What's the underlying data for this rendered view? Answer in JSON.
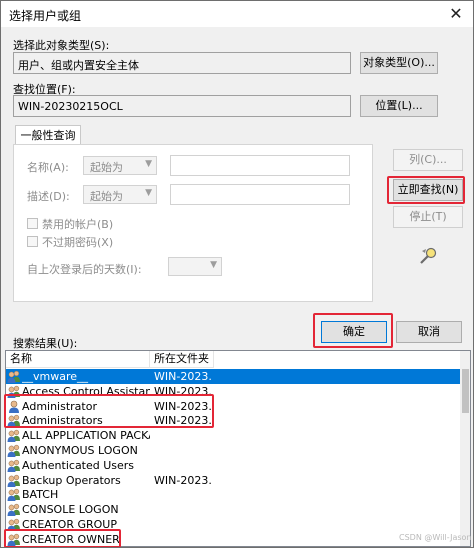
{
  "window": {
    "title": "选择用户或组"
  },
  "object_type": {
    "label": "选择此对象类型(S):",
    "value": "用户、组或内置安全主体",
    "button": "对象类型(O)..."
  },
  "location": {
    "label": "查找位置(F):",
    "value": "WIN-20230215OCL",
    "button": "位置(L)..."
  },
  "tab": {
    "label": "一般性查询"
  },
  "query": {
    "name_label": "名称(A):",
    "name_mode": "起始为",
    "desc_label": "描述(D):",
    "desc_mode": "起始为",
    "disabled_accounts": "禁用的帐户(B)",
    "no_expire": "不过期密码(X)",
    "days_label": "自上次登录后的天数(I):"
  },
  "buttons": {
    "columns": "列(C)...",
    "find_now": "立即查找(N)",
    "stop": "停止(T)",
    "ok": "确定",
    "cancel": "取消"
  },
  "results": {
    "label": "搜索结果(U):",
    "headers": {
      "name": "名称",
      "folder": "所在文件夹"
    },
    "rows": [
      {
        "name": "__vmware__",
        "folder": "WIN-2023...",
        "selected": true
      },
      {
        "name": "Access Control Assistance ...",
        "folder": "WIN-2023..."
      },
      {
        "name": "Administrator",
        "folder": "WIN-2023..."
      },
      {
        "name": "Administrators",
        "folder": "WIN-2023..."
      },
      {
        "name": "ALL APPLICATION PACKA...",
        "folder": ""
      },
      {
        "name": "ANONYMOUS LOGON",
        "folder": ""
      },
      {
        "name": "Authenticated Users",
        "folder": ""
      },
      {
        "name": "Backup Operators",
        "folder": "WIN-2023..."
      },
      {
        "name": "BATCH",
        "folder": ""
      },
      {
        "name": "CONSOLE LOGON",
        "folder": ""
      },
      {
        "name": "CREATOR GROUP",
        "folder": ""
      },
      {
        "name": "CREATOR OWNER",
        "folder": ""
      }
    ]
  },
  "watermark": "CSDN @Will-Jason",
  "icons": {
    "close": "close-icon",
    "user": "user-icon",
    "group": "group-icon",
    "search": "search-icon"
  },
  "colors": {
    "selection": "#0078d7",
    "highlight_box": "#e32636"
  }
}
